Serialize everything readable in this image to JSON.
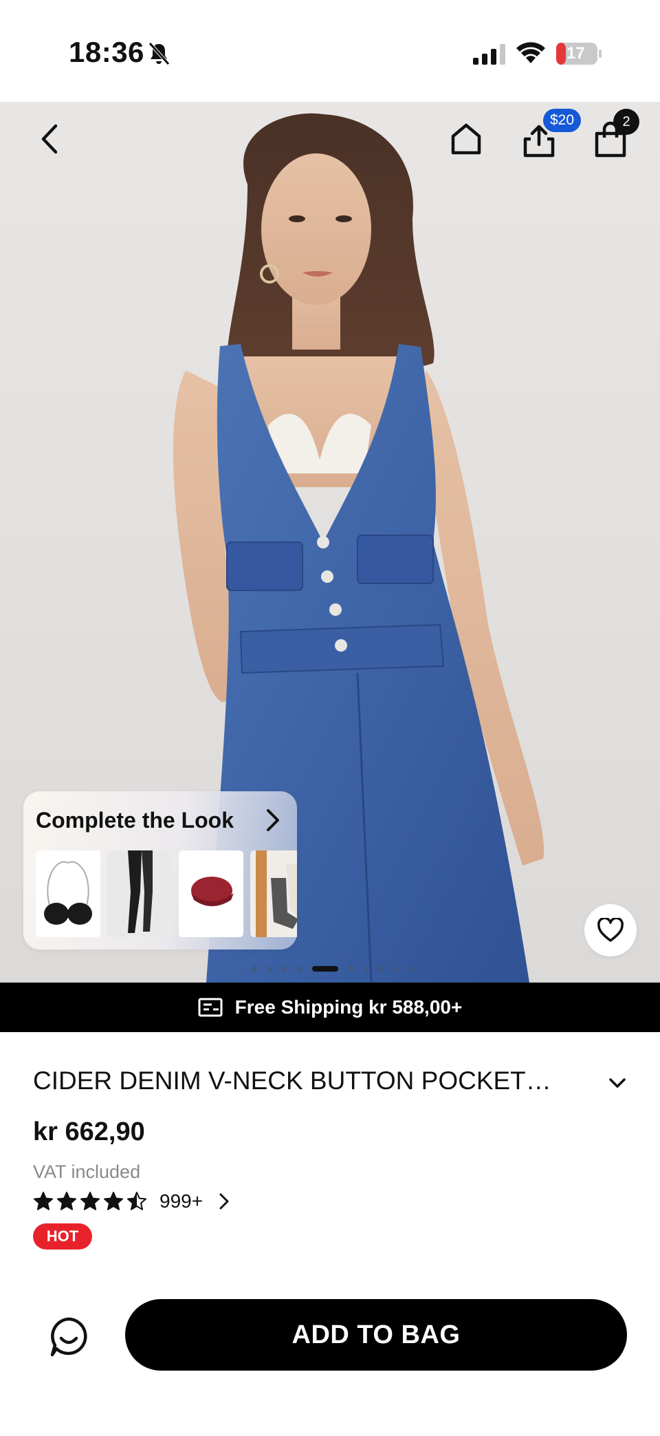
{
  "status_bar": {
    "time": "18:36",
    "battery": "17",
    "icons": [
      "bell-slash-icon",
      "signal-icon",
      "wifi-icon",
      "battery-icon"
    ]
  },
  "header": {
    "icons": [
      "back-icon",
      "home-icon",
      "share-icon",
      "bag-icon"
    ],
    "share_badge": "$20",
    "bag_count": "2"
  },
  "complete_look": {
    "title": "Complete the Look",
    "items": [
      "bra",
      "tights",
      "beret",
      "socks"
    ]
  },
  "gallery": {
    "total": 10,
    "active_index": 4
  },
  "shipping": {
    "text": "Free Shipping kr 588,00+",
    "icon": "shipping-icon"
  },
  "product": {
    "title": "CIDER DENIM V-NECK BUTTON POCKET…",
    "price": "kr 662,90",
    "vat": "VAT included",
    "rating": 4.5,
    "rating_count": "999+",
    "badge": "HOT"
  },
  "actions": {
    "add_to_bag": "ADD TO BAG",
    "chat_icon": "chat-icon"
  },
  "colors": {
    "accent": "#000000",
    "hot": "#e8222b",
    "badge_blue": "#1559d6"
  }
}
